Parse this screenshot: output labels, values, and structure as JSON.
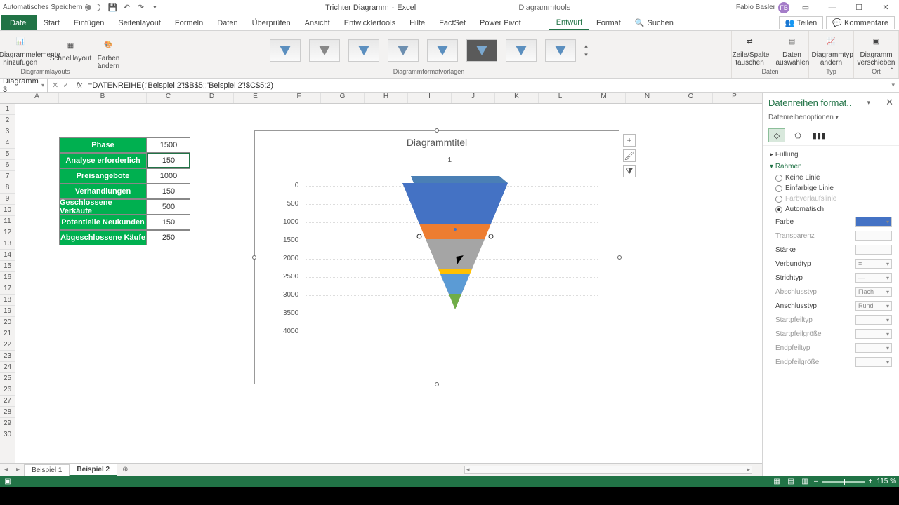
{
  "titlebar": {
    "auto_save": "Automatisches Speichern",
    "doc_name": "Trichter Diagramm",
    "app_name": "Excel",
    "tools_context": "Diagrammtools",
    "user_name": "Fabio Basler",
    "user_initials": "FB"
  },
  "ribbon_tabs": {
    "file": "Datei",
    "items": [
      "Start",
      "Einfügen",
      "Seitenlayout",
      "Formeln",
      "Daten",
      "Überprüfen",
      "Ansicht",
      "Entwicklertools",
      "Hilfe",
      "FactSet",
      "Power Pivot"
    ],
    "context_items": [
      "Entwurf",
      "Format"
    ],
    "active": "Entwurf",
    "search": "Suchen",
    "share": "Teilen",
    "comments": "Kommentare"
  },
  "ribbon": {
    "layouts_group": "Diagrammlayouts",
    "add_element": "Diagrammelemente hinzufügen",
    "quick_layout": "Schnelllayout",
    "change_colors": "Farben ändern",
    "styles_group": "Diagrammformatvorlagen",
    "data_group": "Daten",
    "switch_rc": "Zeile/Spalte tauschen",
    "select_data": "Daten auswählen",
    "type_group": "Typ",
    "change_type": "Diagrammtyp ändern",
    "location_group": "Ort",
    "move_chart": "Diagramm verschieben"
  },
  "name_box": "Diagramm 3",
  "formula": "=DATENREIHE(;'Beispiel 2'!$B$5;;'Beispiel 2'!$C$5;2)",
  "columns": [
    "A",
    "B",
    "C",
    "D",
    "E",
    "F",
    "G",
    "H",
    "I",
    "J",
    "K",
    "L",
    "M",
    "N",
    "O",
    "P"
  ],
  "table": {
    "header": {
      "phase": "Phase",
      "value": "1500"
    },
    "rows": [
      {
        "phase": "Analyse erforderlich",
        "value": "150"
      },
      {
        "phase": "Preisangebote",
        "value": "1000"
      },
      {
        "phase": "Verhandlungen",
        "value": "150"
      },
      {
        "phase": "Geschlossene Verkäufe",
        "value": "500"
      },
      {
        "phase": "Potentielle Neukunden",
        "value": "150"
      },
      {
        "phase": "Abgeschlossene Käufe",
        "value": "250"
      }
    ]
  },
  "chart_data": {
    "type": "bar",
    "title": "Diagrammtitel",
    "legend": "1",
    "categories": [
      "Phase",
      "Analyse erforderlich",
      "Preisangebote",
      "Verhandlungen",
      "Geschlossene Verkäufe",
      "Potentielle Neukunden",
      "Abgeschlossene Käufe"
    ],
    "values": [
      1500,
      150,
      1000,
      150,
      500,
      150,
      250
    ],
    "yticks": [
      "0",
      "500",
      "1000",
      "1500",
      "2000",
      "2500",
      "3000",
      "3500",
      "4000"
    ],
    "ylim": [
      0,
      4000
    ],
    "xlabel": "",
    "ylabel": ""
  },
  "pane": {
    "title": "Datenreihen format..",
    "subtitle": "Datenreihenoptionen",
    "sections": {
      "fill": "Füllung",
      "border": "Rahmen"
    },
    "border_opts": {
      "none": "Keine Linie",
      "solid": "Einfarbige Linie",
      "gradient": "Farbverlaufslinie",
      "auto": "Automatisch"
    },
    "props": {
      "color": "Farbe",
      "transparency": "Transparenz",
      "width": "Stärke",
      "compound": "Verbundtyp",
      "dash": "Strichtyp",
      "cap": "Abschlusstyp",
      "cap_val": "Flach",
      "join": "Anschlusstyp",
      "join_val": "Rund",
      "begin_arrow": "Startpfeiltyp",
      "begin_size": "Startpfeilgröße",
      "end_arrow": "Endpfeiltyp",
      "end_size": "Endpfeilgröße"
    }
  },
  "sheets": {
    "s1": "Beispiel 1",
    "s2": "Beispiel 2"
  },
  "status": {
    "zoom": "115 %"
  }
}
